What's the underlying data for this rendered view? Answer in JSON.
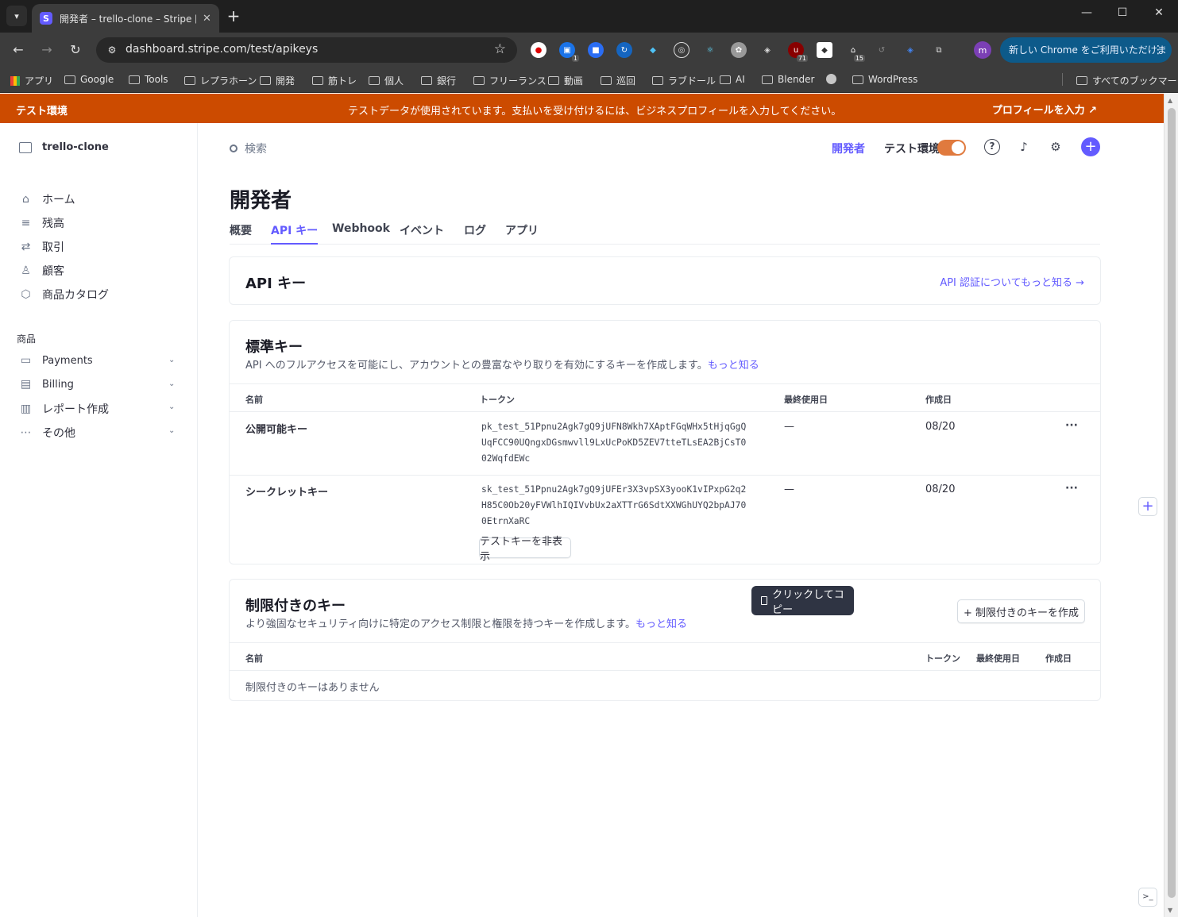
{
  "browser": {
    "tab_title": "開発者 – trello-clone – Stripe [テ",
    "tab_favicon": "S",
    "url": "dashboard.stripe.com/test/apikeys",
    "profile_initial": "m",
    "update_label": "新しい Chrome をご利用いただけます",
    "extension_badges": [
      "1",
      "71",
      "15"
    ],
    "bookmarks": [
      "アプリ",
      "Google",
      "Tools",
      "レプラホーン",
      "開発",
      "筋トレ",
      "個人",
      "銀行",
      "フリーランス",
      "動画",
      "巡回",
      "ラブドール",
      "AI",
      "Blender",
      "WordPress"
    ],
    "all_bookmarks": "すべてのブックマーク"
  },
  "banner": {
    "env": "テスト環境",
    "message": "テストデータが使用されています。支払いを受け付けるには、ビジネスプロフィールを入力してください。",
    "cta": "プロフィールを入力 ↗",
    "color": "#cc4b00"
  },
  "sidebar": {
    "account": "trello-clone",
    "nav": [
      "ホーム",
      "残高",
      "取引",
      "顧客",
      "商品カタログ"
    ],
    "section_label": "商品",
    "products": [
      "Payments",
      "Billing",
      "レポート作成",
      "その他"
    ]
  },
  "topbar": {
    "search_placeholder": "検索",
    "developers": "開発者",
    "test_env": "テスト環境"
  },
  "page": {
    "title": "開発者",
    "tabs": [
      "概要",
      "API キー",
      "Webhook",
      "イベント",
      "ログ",
      "アプリ"
    ],
    "active_tab": "API キー"
  },
  "api_card": {
    "title": "API キー",
    "link": "API 認証についてもっと知る →"
  },
  "standard": {
    "title": "標準キー",
    "desc": "API へのフルアクセスを可能にし、アカウントとの豊富なやり取りを有効にするキーを作成します。",
    "learn_more": "もっと知る",
    "headers": {
      "name": "名前",
      "token": "トークン",
      "last_used": "最終使用日",
      "created": "作成日"
    },
    "rows": [
      {
        "name": "公開可能キー",
        "token": "pk_test_51Ppnu2Agk7gQ9jUFN8Wkh7XAptFGqWHx5tHjqGgQUqFCC90UQngxDGsmwvll9LxUcPoKD5ZEV7tteTLsEA2BjCsT002WqfdEWc",
        "last_used": "—",
        "created": "08/20"
      },
      {
        "name": "シークレットキー",
        "token": "sk_test_51Ppnu2Agk7gQ9jUFEr3X3vpSX3yooK1vIPxpG2q2H85C0Ob20yFVWlhIQIVvbUx2aXTTrG6SdtXXWGhUYQ2bpAJ700EtrnXaRC",
        "last_used": "—",
        "created": "08/20"
      }
    ],
    "hide_button": "テストキーを非表示",
    "tooltip": "クリックしてコピー"
  },
  "restricted": {
    "title": "制限付きのキー",
    "desc": "より強固なセキュリティ向けに特定のアクセス制限と権限を持つキーを作成します。",
    "learn_more": "もっと知る",
    "create_button": "+ 制限付きのキーを作成",
    "headers": {
      "name": "名前",
      "token": "トークン",
      "last_used": "最終使用日",
      "created": "作成日"
    },
    "empty": "制限付きのキーはありません"
  },
  "colors": {
    "accent": "#635bff",
    "toggle": "#e07a3e"
  }
}
